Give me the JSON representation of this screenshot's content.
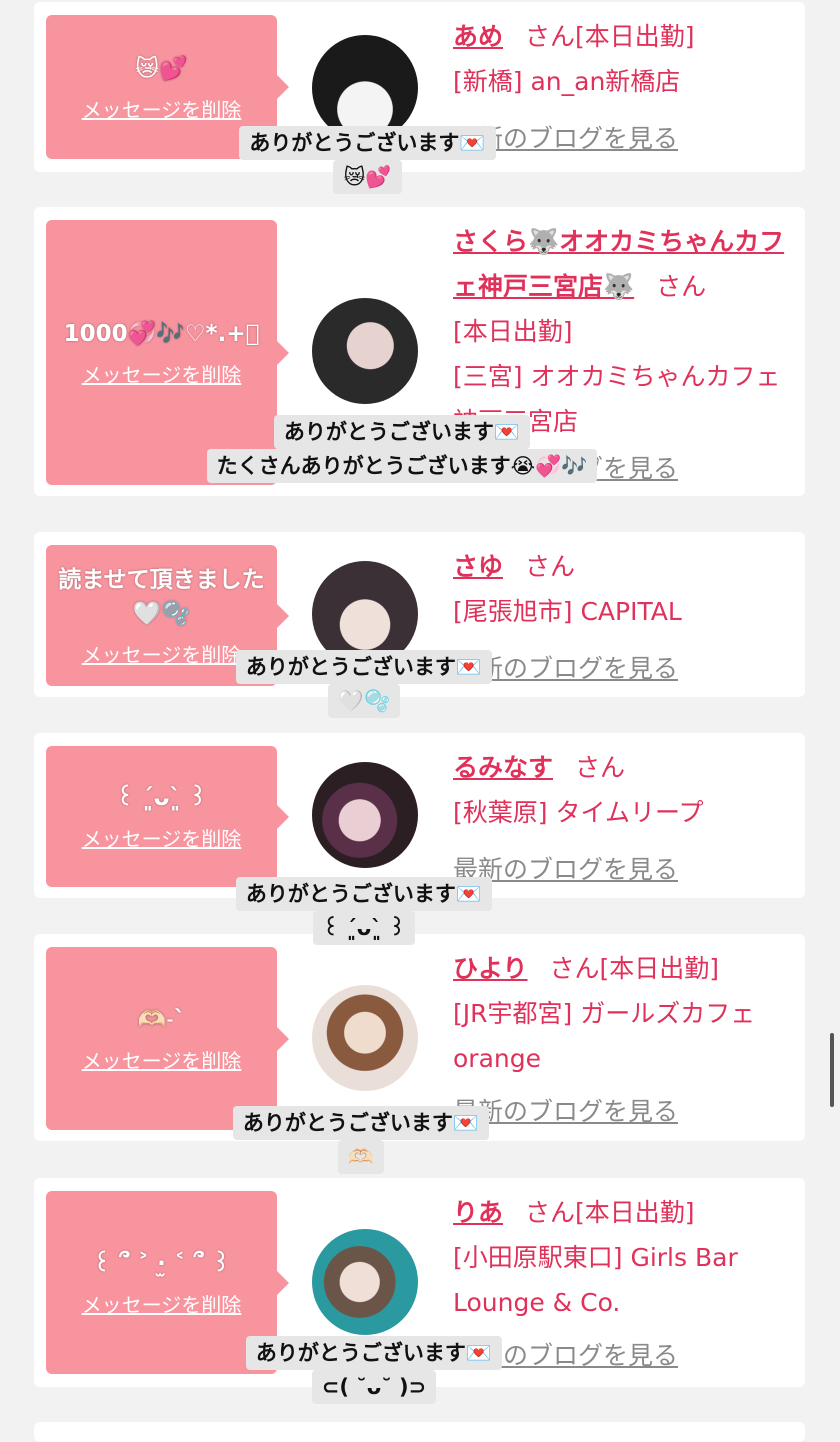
{
  "cards": [
    {
      "bubble_msg": "😿💕",
      "delete_label": "メッセージを削除",
      "name": "あめ",
      "san": "さん",
      "status": "[本日出勤]",
      "line2": "[新橋] an_an新橋店",
      "line3": "",
      "blog": "最新のブログを見る",
      "reply1": "ありがとうございます💌",
      "reply2": "😿💕",
      "avatar_colors": [
        "#1a1a1a",
        "#e8d4c8"
      ]
    },
    {
      "bubble_msg": "1000💞🎶♡*.+ﾟ",
      "delete_label": "メッセージを削除",
      "name": "さくら🐺オオカミちゃんカフェ神戸三宮店🐺",
      "san": "さん",
      "status": "[本日出勤]",
      "line2": "[三宮] オオカミちゃんカフェ神戸三宮店",
      "line3": "",
      "blog": "最新のブログを見る",
      "reply1": "ありがとうございます💌",
      "reply2": "たくさんありがとうございます😭💞🎶",
      "avatar_colors": [
        "#2a2a2a",
        "#d9c8c6"
      ]
    },
    {
      "bubble_msg": "読ませて頂きました🤍🫧",
      "delete_label": "メッセージを削除",
      "name": "さゆ",
      "san": "さん",
      "status": "",
      "line2": "[尾張旭市] CAPITAL",
      "line3": "",
      "blog": "最新のブログを見る",
      "reply1": "ありがとうございます💌",
      "reply2": "🤍🫧",
      "avatar_colors": [
        "#3a3035",
        "#e9d8d2"
      ]
    },
    {
      "bubble_msg": "꒰ ´͈ᴗ`͈ ꒱",
      "delete_label": "メッセージを削除",
      "name": "るみなす",
      "san": "さん",
      "status": "",
      "line2": "[秋葉原] タイムリープ",
      "line3": "",
      "blog": "最新のブログを見る",
      "reply1": "ありがとうございます💌",
      "reply2": "꒰ ´͈ᴗ`͈ ꒱",
      "avatar_colors": [
        "#2b1f24",
        "#c98ea8"
      ]
    },
    {
      "bubble_msg": "🫶🏻˗ˋ",
      "delete_label": "メッセージを削除",
      "name": "ひより",
      "san": "さん",
      "status": "[本日出勤]",
      "line2": "[JR宇都宮] ガールズカフェ",
      "line3": "orange",
      "blog": "最新のブログを見る",
      "reply1": "ありがとうございます💌",
      "reply2": "🫶🏻",
      "avatar_colors": [
        "#8a5a3f",
        "#eadfd8"
      ]
    },
    {
      "bubble_msg": "꒰ ՞ ˃ ·̫ ˂ ՞ ꒱",
      "delete_label": "メッセージを削除",
      "name": "りあ",
      "san": "さん",
      "status": "[本日出勤]",
      "line2": "[小田原駅東口] Girls Bar",
      "line3": "Lounge & Co.",
      "blog": "最新のブログを見る",
      "reply1": "ありがとうございます💌",
      "reply2": "⊂( ˘ᴗ˘ )⊃",
      "avatar_colors": [
        "#2a9aa0",
        "#d7c6bf"
      ]
    }
  ]
}
